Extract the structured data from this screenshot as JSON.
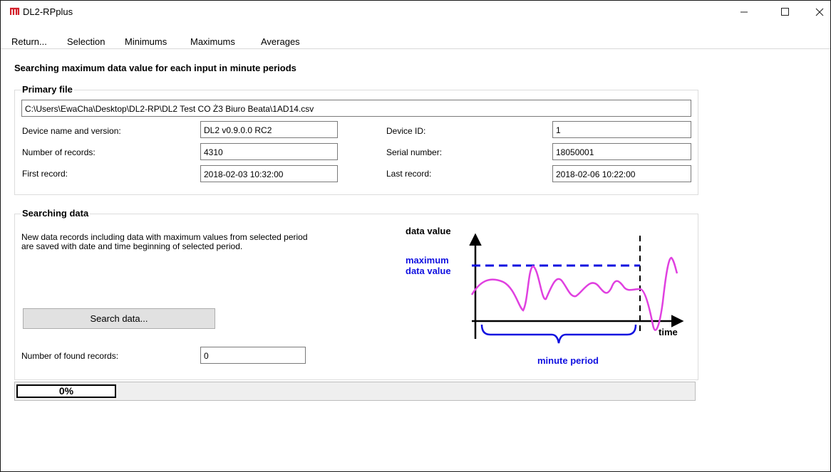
{
  "window": {
    "title": "DL2-RPplus"
  },
  "menu": [
    "Return...",
    "Selection",
    "Minimums",
    "Maximums",
    "Averages"
  ],
  "heading": "Searching maximum data value for each input in minute periods",
  "primary_file": {
    "title": "Primary file",
    "path": "C:\\Users\\EwaCha\\Desktop\\DL2-RP\\DL2 Test CO Ż3 Biuro Beata\\1AD14.csv",
    "device_name_label": "Device name and version:",
    "device_name": "DL2 v0.9.0.0 RC2",
    "records_label": "Number of records:",
    "records": "4310",
    "first_label": "First record:",
    "first": "2018-02-03 10:32:00",
    "device_id_label": "Device ID:",
    "device_id": "1",
    "serial_label": "Serial number:",
    "serial": "18050001",
    "last_label": "Last record:",
    "last": "2018-02-06 10:22:00"
  },
  "searching": {
    "title": "Searching data",
    "description_line1": "New data records including data with maximum values from selected period",
    "description_line2": "are saved with date and time beginning of selected period.",
    "button": "Search data...",
    "found_label": "Number of found records:",
    "found": "0"
  },
  "diagram": {
    "y_label": "data value",
    "max_label_line1": "maximum",
    "max_label_line2": "data value",
    "x_label": "time",
    "period_label": "minute period",
    "colors": {
      "curve": "#e040e0",
      "max_line": "#1010e0",
      "period": "#1010e0"
    }
  },
  "progress": {
    "text": "0%",
    "value": 0.0
  }
}
